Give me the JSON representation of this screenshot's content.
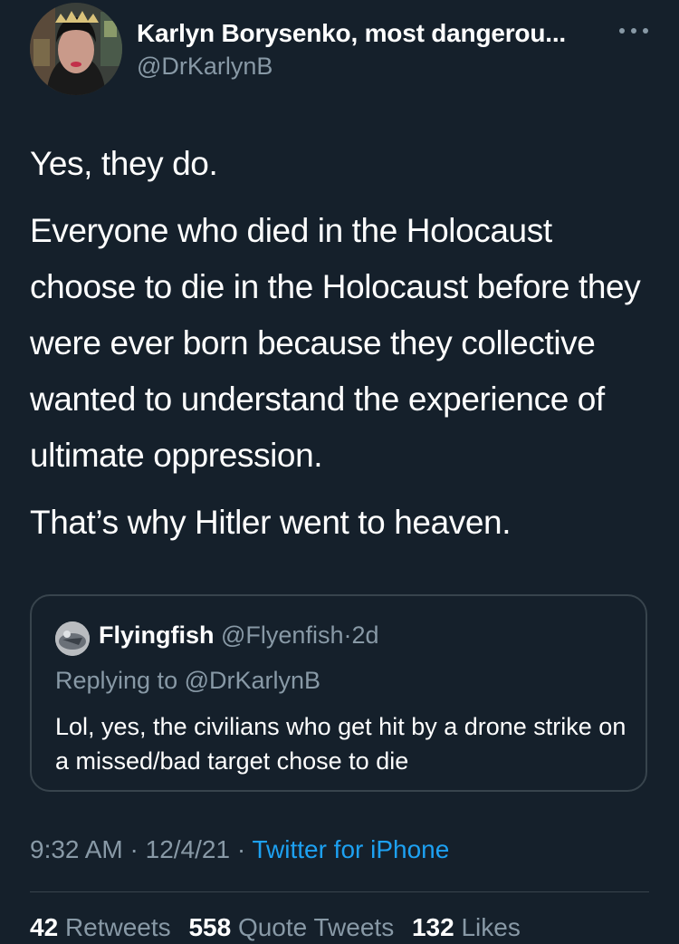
{
  "author": {
    "name": "Karlyn Borysenko, most dangerou...",
    "handle": "@DrKarlynB"
  },
  "tweet": {
    "paragraphs": [
      "Yes, they do.",
      "Everyone who died in the Holocaust choose to die in the Holocaust before they were ever born because they collective wanted to understand the experience of ultimate oppression.",
      "That’s why Hitler went to heaven."
    ]
  },
  "quoted_tweet": {
    "name": "Flyingfish",
    "handle": "@Flyenfish",
    "separator": "·",
    "age": "2d",
    "replying_prefix": "Replying to",
    "replying_to": "@DrKarlynB",
    "text": "Lol, yes, the civilians who get hit by a drone strike on a missed/bad target chose to die"
  },
  "meta": {
    "time": "9:32 AM",
    "date": "12/4/21",
    "separator": "·",
    "source": "Twitter for iPhone"
  },
  "stats": {
    "retweets_count": "42",
    "retweets_label": "Retweets",
    "quote_tweets_count": "558",
    "quote_tweets_label": "Quote Tweets",
    "likes_count": "132",
    "likes_label": "Likes"
  },
  "colors": {
    "background": "#15202b",
    "secondary_text": "#8899a6",
    "link": "#1da1f2",
    "border": "#38444d"
  },
  "icons": {
    "more": "more-horizontal-icon"
  }
}
